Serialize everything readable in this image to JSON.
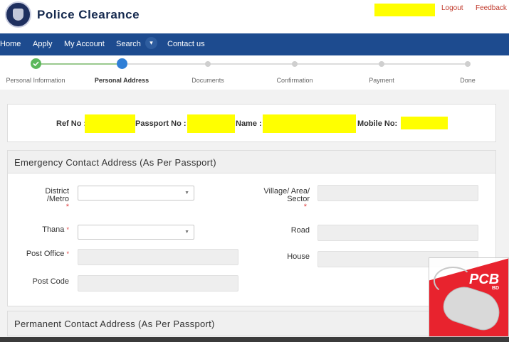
{
  "header": {
    "brand": "Police Clearance",
    "logout": "Logout",
    "feedback": "Feedback"
  },
  "nav": {
    "items": [
      "Home",
      "Apply",
      "My Account",
      "Search",
      "Contact us"
    ]
  },
  "stepper": {
    "steps": [
      {
        "label": "Personal Information",
        "state": "done"
      },
      {
        "label": "Personal Address",
        "state": "active"
      },
      {
        "label": "Documents",
        "state": "pending"
      },
      {
        "label": "Confirmation",
        "state": "pending"
      },
      {
        "label": "Payment",
        "state": "pending"
      },
      {
        "label": "Done",
        "state": "pending"
      }
    ]
  },
  "reference": {
    "ref_no_label": "Ref No :",
    "passport_no_label": "Passport No :",
    "name_label": "Name :",
    "mobile_no_label": "Mobile No:"
  },
  "emergency": {
    "title": "Emergency Contact Address (As Per Passport)",
    "district_label": "District /Metro",
    "thana_label": "Thana",
    "post_office_label": "Post Office",
    "post_code_label": "Post Code",
    "village_label": "Village/ Area/ Sector",
    "road_label": "Road",
    "house_label": "House",
    "required_mark": "*"
  },
  "permanent": {
    "title": "Permanent Contact Address (As Per Passport)"
  },
  "watermark": {
    "text": "PCB",
    "sub": "BD"
  },
  "colors": {
    "nav": "#1d4b8f",
    "step_done": "#5cb85c",
    "step_active": "#2f7fd6",
    "redaction": "#ffff00",
    "required": "#e04040"
  }
}
